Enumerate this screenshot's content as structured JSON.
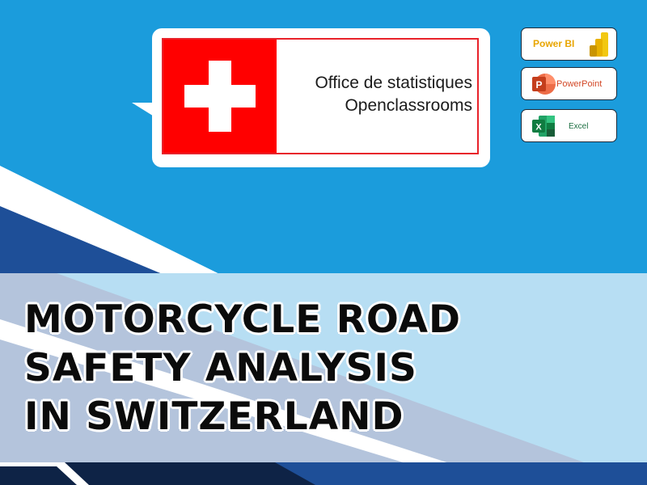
{
  "logo": {
    "line1": "Office de statistiques",
    "line2": "Openclassrooms",
    "flag_color": "#ff0000"
  },
  "tools": {
    "powerbi": {
      "label": "Power BI",
      "icon": "powerbi-icon",
      "color": "#e8a500"
    },
    "powerpoint": {
      "label": "PowerPoint",
      "icon": "powerpoint-icon",
      "color": "#d24726"
    },
    "excel": {
      "label": "Excel",
      "icon": "excel-icon",
      "color": "#1d6f42"
    }
  },
  "title": {
    "line1": "MOTORCYCLE ROAD",
    "line2": "SAFETY ANALYSIS",
    "line3": "IN SWITZERLAND"
  },
  "colors": {
    "sky_blue": "#1b9cdc",
    "navy": "#1e4f98",
    "light_blue": "#b7def3",
    "steel": "#b4c4dc",
    "dark_navy": "#0e2346"
  }
}
